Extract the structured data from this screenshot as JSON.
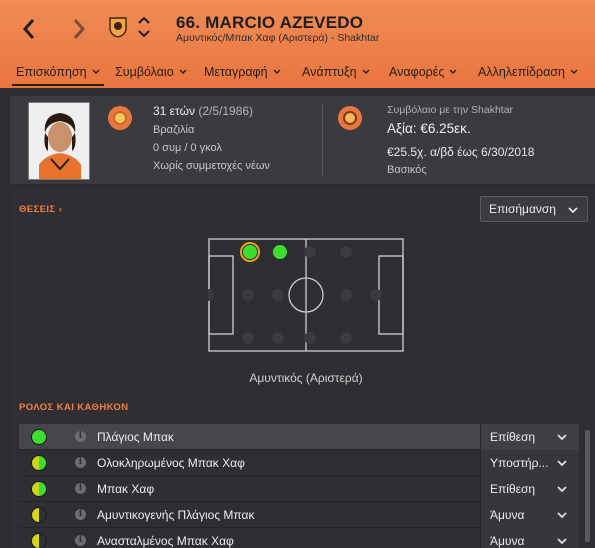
{
  "header": {
    "title": "66. MARCIO AZEVEDO",
    "subtitle": "Αμυντικός/Μπακ Χαφ (Αριστερά) - Shakhtar",
    "accent_color": "#e9753f"
  },
  "tabs": [
    {
      "label": "Επισκόπηση",
      "active": true
    },
    {
      "label": "Συμβόλαιο"
    },
    {
      "label": "Μεταγραφή"
    },
    {
      "label": "Ανάπτυξη"
    },
    {
      "label": "Αναφορές"
    },
    {
      "label": "Αλληλεπίδραση"
    }
  ],
  "info": {
    "age": "31 ετών",
    "dob": "(2/5/1986)",
    "nationality": "Βραζιλία",
    "caps": "0 συμ / 0 γκολ",
    "youth": "Χωρίς συμμετοχές νέων"
  },
  "contract": {
    "label": "Συμβόλαιο με την Shakhtar",
    "value": "Αξία: €6.25εκ.",
    "wage": "€25.5χ. α/βδ έως 6/30/2018",
    "type": "Βασικός"
  },
  "positions": {
    "heading": "ΘΕΣΕΙΣ",
    "dropdown": "Επισήμανση",
    "pitch_label": "Αμυντικός (Αριστερά)"
  },
  "roles": {
    "heading": "ΡΟΛΟΣ ΚΑΙ ΚΑΘΗΚΟΝ",
    "items": [
      {
        "name": "Πλάγιος Μπακ",
        "duty": "Επίθεση",
        "rating": "full"
      },
      {
        "name": "Ολοκληρωμένος Μπακ Χαφ",
        "duty": "Υποστήρ...",
        "rating": "half"
      },
      {
        "name": "Μπακ Χαφ",
        "duty": "Επίθεση",
        "rating": "half"
      },
      {
        "name": "Αμυντικογενής Πλάγιος Μπακ",
        "duty": "Άμυνα",
        "rating": "partial"
      },
      {
        "name": "Ανασταλμένος Μπακ Χαφ",
        "duty": "Άμυνα",
        "rating": "partial"
      }
    ]
  },
  "icons": {
    "back": "chevron-left-icon",
    "forward": "chevron-right-icon",
    "crest": "club-crest-icon",
    "updown": "up-down-icon",
    "info": "info-icon",
    "dropdown": "chevron-down-icon"
  }
}
